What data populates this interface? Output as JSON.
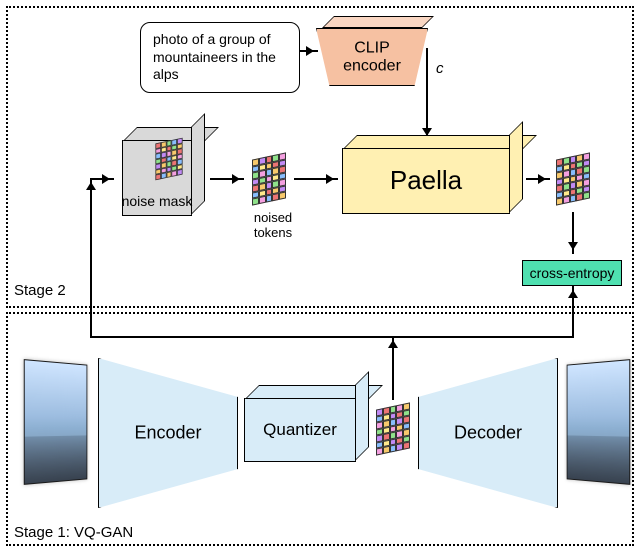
{
  "stage2": {
    "label": "Stage 2"
  },
  "stage1": {
    "label": "Stage 1: VQ-GAN"
  },
  "prompt": {
    "text": "photo of a group of mountaineers in the alps"
  },
  "clip": {
    "label": "CLIP\nencoder",
    "output_var": "c"
  },
  "noiseMask": {
    "label": "noise\nmask"
  },
  "noisedTokens": {
    "label": "noised\ntokens"
  },
  "paella": {
    "label": "Paella"
  },
  "crossEntropy": {
    "label": "cross-entropy"
  },
  "encoder": {
    "label": "Encoder"
  },
  "quantizer": {
    "label": "Quantizer"
  },
  "decoder": {
    "label": "Decoder"
  },
  "chart_data": {
    "type": "diagram",
    "title": "Paella two-stage training pipeline",
    "stages": [
      {
        "name": "Stage 1: VQ-GAN",
        "nodes": [
          "input-image",
          "Encoder",
          "Quantizer",
          "token-grid",
          "Decoder",
          "output-image"
        ],
        "edges": [
          [
            "input-image",
            "Encoder"
          ],
          [
            "Encoder",
            "Quantizer"
          ],
          [
            "Quantizer",
            "token-grid"
          ],
          [
            "token-grid",
            "Decoder"
          ],
          [
            "Decoder",
            "output-image"
          ]
        ]
      },
      {
        "name": "Stage 2",
        "nodes": [
          "text-prompt",
          "CLIP encoder",
          "noise mask",
          "noised tokens",
          "Paella",
          "predicted-tokens",
          "cross-entropy"
        ],
        "edges": [
          [
            "text-prompt",
            "CLIP encoder"
          ],
          [
            "CLIP encoder",
            "Paella",
            "c"
          ],
          [
            "token-grid (from Stage 1)",
            "noise mask"
          ],
          [
            "noise mask",
            "noised tokens"
          ],
          [
            "noised tokens",
            "Paella"
          ],
          [
            "Paella",
            "predicted-tokens"
          ],
          [
            "predicted-tokens",
            "cross-entropy"
          ],
          [
            "token-grid (from Stage 1)",
            "cross-entropy"
          ]
        ]
      }
    ]
  }
}
